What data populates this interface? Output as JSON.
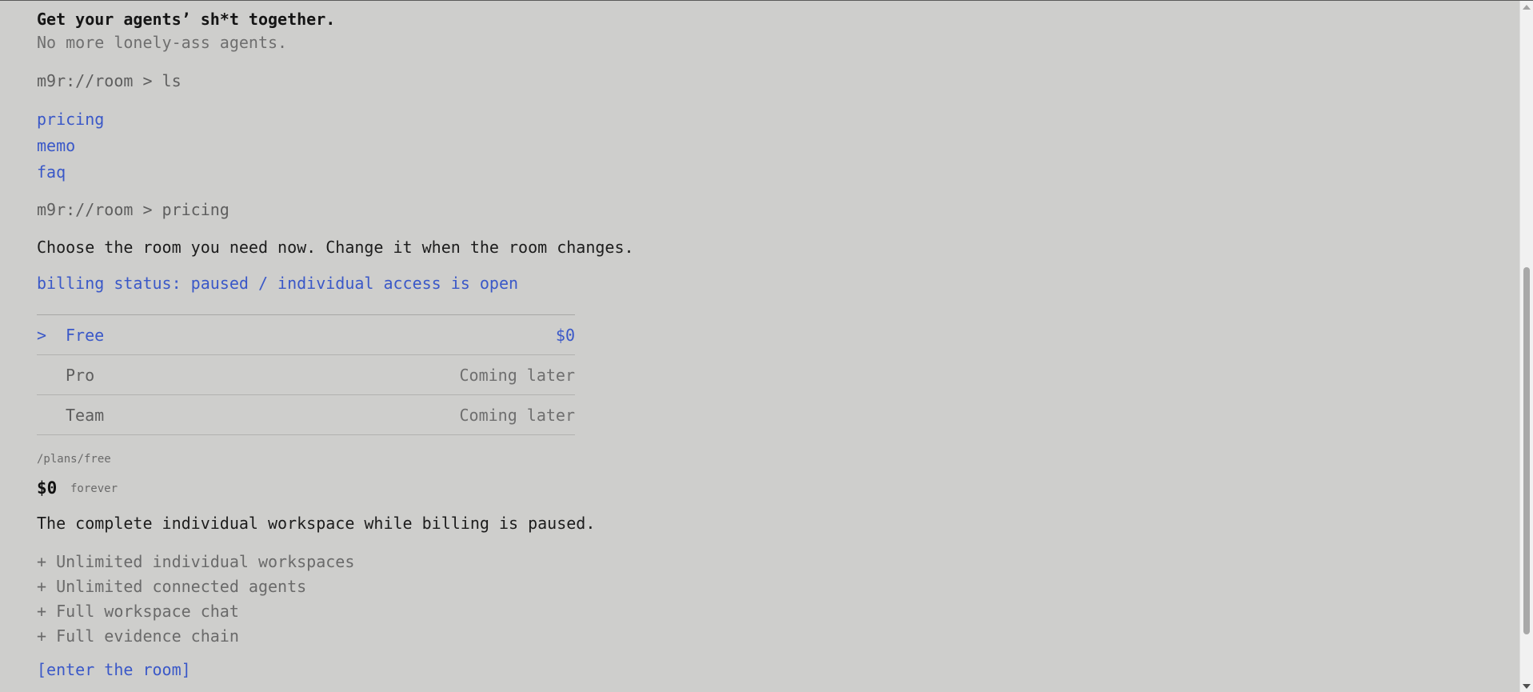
{
  "hero": {
    "headline": "Get your agents’ sh*t together.",
    "subline": "No more lonely-ass agents."
  },
  "terminal": {
    "ls_prompt": "m9r://room > ls",
    "links": [
      "pricing",
      "memo",
      "faq"
    ],
    "pricing_prompt": "m9r://room > pricing"
  },
  "pricing": {
    "intro": "Choose the room you need now. Change it when the room changes.",
    "billing_status": "billing status: paused / individual access is open",
    "selected_marker": ">",
    "plans": [
      {
        "name": "Free",
        "price": "$0",
        "selected": true
      },
      {
        "name": "Pro",
        "price": "Coming later",
        "selected": false
      },
      {
        "name": "Team",
        "price": "Coming later",
        "selected": false
      }
    ]
  },
  "plan_detail": {
    "path": "/plans/free",
    "price": "$0",
    "term": "forever",
    "description": "The complete individual workspace while billing is paused.",
    "features": [
      "+ Unlimited individual workspaces",
      "+ Unlimited connected agents",
      "+ Full workspace chat",
      "+ Full evidence chain"
    ],
    "cta": "[enter the room]"
  },
  "colors": {
    "background": "#cececc",
    "accent": "#3a58c8",
    "text": "#1c1c1c",
    "muted": "#6f6f6f"
  }
}
